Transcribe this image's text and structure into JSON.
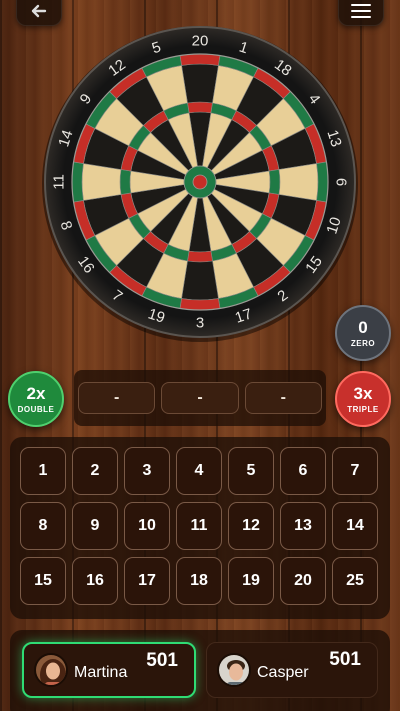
{
  "header": {
    "back_icon": "back-arrow-icon",
    "menu_icon": "hamburger-menu-icon"
  },
  "dartboard": {
    "numbers": [
      "20",
      "1",
      "18",
      "4",
      "13",
      "6",
      "10",
      "15",
      "2",
      "17",
      "3",
      "19",
      "7",
      "16",
      "8",
      "11",
      "14",
      "9",
      "12",
      "5"
    ],
    "colors": {
      "black": "#1c1a17",
      "cream": "#e8cf97",
      "red": "#c62e27",
      "green": "#1f7a45"
    }
  },
  "modifiers": {
    "zero": {
      "value": "0",
      "label": "ZERO"
    },
    "double": {
      "value": "2x",
      "label": "DOUBLE"
    },
    "triple": {
      "value": "3x",
      "label": "TRIPLE"
    }
  },
  "throws": [
    "-",
    "-",
    "-"
  ],
  "keypad": [
    "1",
    "2",
    "3",
    "4",
    "5",
    "6",
    "7",
    "8",
    "9",
    "10",
    "11",
    "12",
    "13",
    "14",
    "15",
    "16",
    "17",
    "18",
    "19",
    "20",
    "25"
  ],
  "players": [
    {
      "name": "Martina",
      "score": "501",
      "active": true
    },
    {
      "name": "Casper",
      "score": "501",
      "active": false
    }
  ],
  "colors": {
    "active_border": "#2fdc74",
    "double": "#1f8a3c",
    "triple": "#c8302c",
    "zero": "#3b3f46"
  }
}
